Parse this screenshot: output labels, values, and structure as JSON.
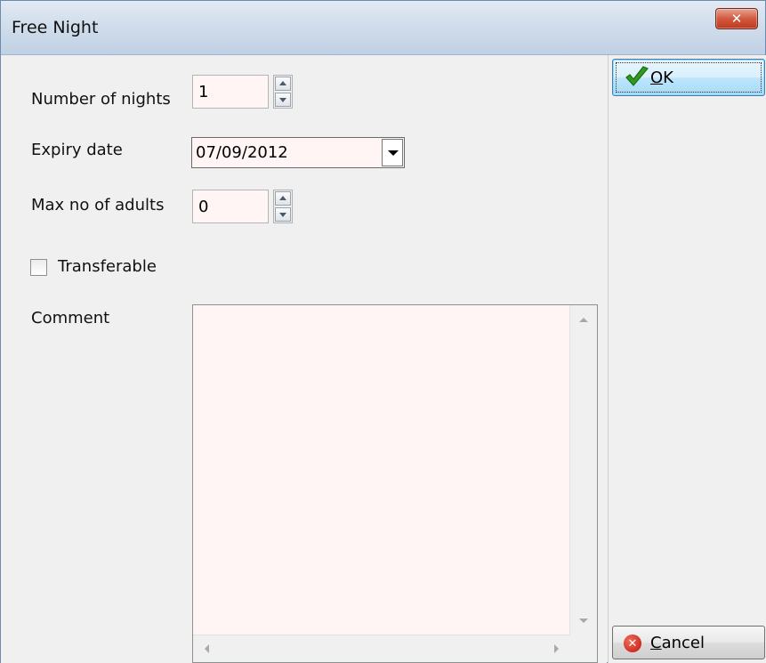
{
  "window": {
    "title": "Free Night",
    "close_glyph": "✕"
  },
  "form": {
    "nights_label": "Number of nights",
    "nights_value": "1",
    "expiry_label": "Expiry date",
    "expiry_value": "07/09/2012",
    "adults_label": "Max no of adults",
    "adults_value": "0",
    "transferable_label": "Transferable",
    "transferable_checked": false,
    "comment_label": "Comment",
    "comment_value": ""
  },
  "buttons": {
    "ok_mnemonic": "O",
    "ok_rest": "K",
    "cancel_mnemonic": "C",
    "cancel_rest": "ancel",
    "cancel_glyph": "✕"
  },
  "icons": {
    "ok": "checkmark-icon",
    "cancel": "cancel-icon",
    "close": "close-icon"
  },
  "colors": {
    "field_background": "#fff5f5",
    "title_gradient_top": "#e2eaf4",
    "close_button": "#c1381c",
    "ok_check": "#2e9a1e"
  }
}
